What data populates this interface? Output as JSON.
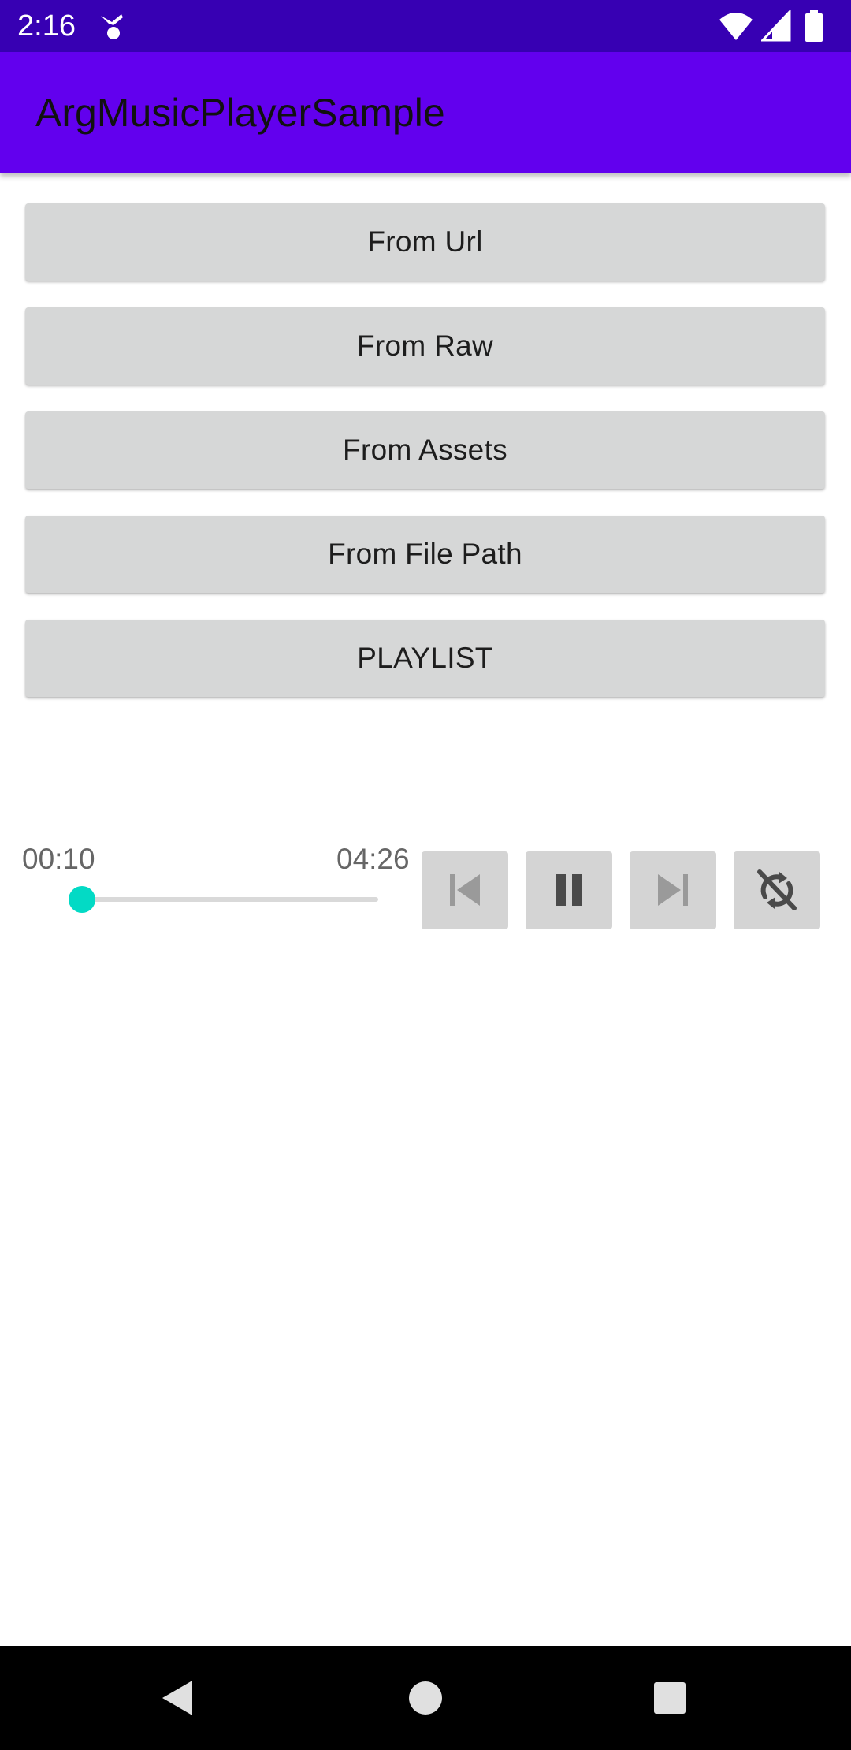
{
  "status_bar": {
    "time": "2:16",
    "icons": [
      "notification-app-icon",
      "wifi-icon",
      "cell-signal-icon",
      "battery-icon"
    ]
  },
  "app_bar": {
    "title": "ArgMusicPlayerSample",
    "background": "#6200ee"
  },
  "buttons": [
    {
      "label": "From Url"
    },
    {
      "label": "From Raw"
    },
    {
      "label": "From Assets"
    },
    {
      "label": "From File Path"
    },
    {
      "label": "PLAYLIST"
    }
  ],
  "player": {
    "elapsed": "00:10",
    "duration": "04:26",
    "progress_fraction": 0.04,
    "accent_color": "#03dac5",
    "controls": [
      "skip-previous-icon",
      "pause-icon",
      "skip-next-icon",
      "repeat-off-icon"
    ]
  },
  "navigation": {
    "icons": [
      "back-icon",
      "home-icon",
      "recents-icon"
    ]
  }
}
